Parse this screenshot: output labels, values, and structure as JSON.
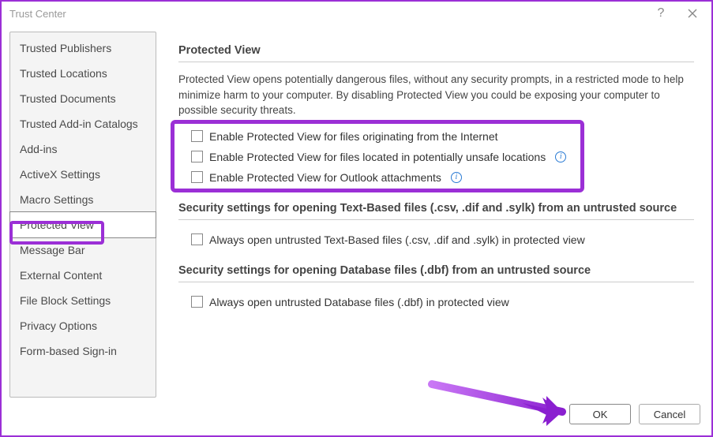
{
  "window": {
    "title": "Trust Center"
  },
  "sidebar": {
    "items": [
      "Trusted Publishers",
      "Trusted Locations",
      "Trusted Documents",
      "Trusted Add-in Catalogs",
      "Add-ins",
      "ActiveX Settings",
      "Macro Settings",
      "Protected View",
      "Message Bar",
      "External Content",
      "File Block Settings",
      "Privacy Options",
      "Form-based Sign-in"
    ],
    "selected_index": 7
  },
  "sections": {
    "protected_view": {
      "title": "Protected View",
      "description": "Protected View opens potentially dangerous files, without any security prompts, in a restricted mode to help minimize harm to your computer. By disabling Protected View you could be exposing your computer to possible security threats.",
      "checks": [
        {
          "label": "Enable Protected View for files originating from the Internet",
          "info": false,
          "checked": false
        },
        {
          "label": "Enable Protected View for files located in potentially unsafe locations",
          "info": true,
          "checked": false
        },
        {
          "label": "Enable Protected View for Outlook attachments",
          "info": true,
          "checked": false
        }
      ]
    },
    "text_based": {
      "title": "Security settings for opening Text-Based files (.csv, .dif and .sylk) from an untrusted source",
      "checks": [
        {
          "label": "Always open untrusted Text-Based files (.csv, .dif and .sylk) in protected view",
          "info": false,
          "checked": false
        }
      ]
    },
    "database": {
      "title": "Security settings for opening Database files (.dbf) from an untrusted source",
      "checks": [
        {
          "label": "Always open untrusted Database files (.dbf) in protected view",
          "info": false,
          "checked": false
        }
      ]
    }
  },
  "buttons": {
    "ok": "OK",
    "cancel": "Cancel"
  },
  "highlight_color": "#9b2fd6"
}
